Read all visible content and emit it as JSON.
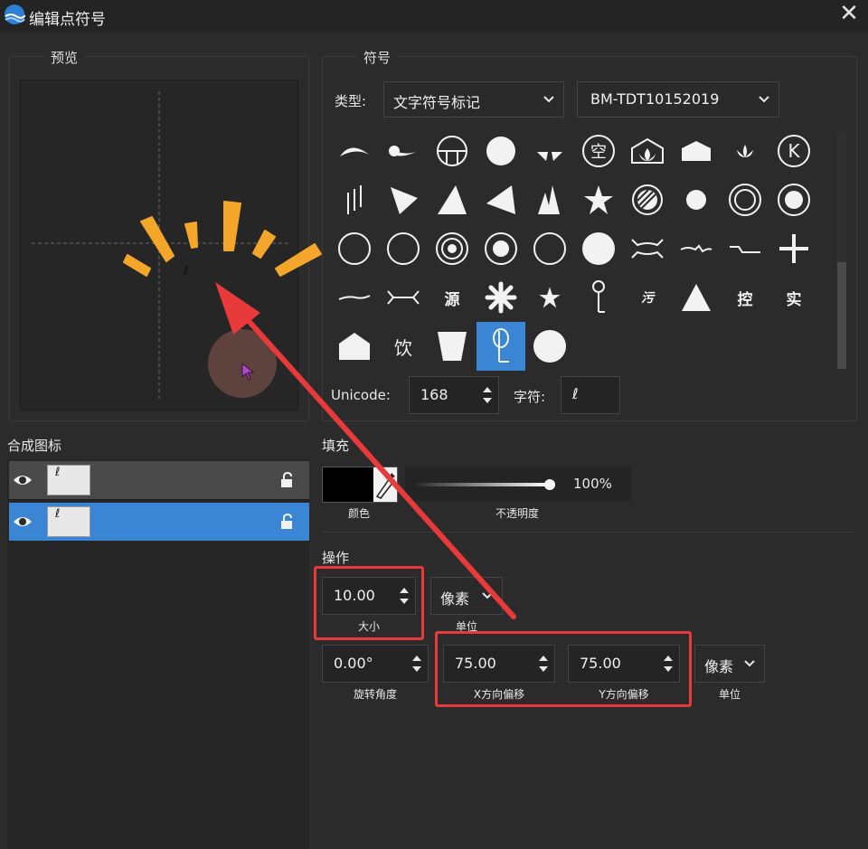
{
  "window": {
    "title": "编辑点符号",
    "close_icon": "close-icon"
  },
  "preview": {
    "group_title": "预览",
    "symbol_glyph": "ℓ"
  },
  "symbol": {
    "group_title": "符号",
    "type_label": "类型:",
    "type_value": "文字符号标记",
    "font_value": "BM-TDT10152019",
    "grid_text_items": {
      "yuan": "源",
      "wu": "污",
      "kong": "控",
      "shi": "实",
      "yin": "饮",
      "kong_circle": "空",
      "k": "K"
    },
    "unicode_label": "Unicode:",
    "unicode_value": "168",
    "char_label": "字符:",
    "char_value": "ℓ"
  },
  "layers": {
    "title": "合成图标",
    "items": [
      {
        "glyph": "ℓ",
        "selected": false
      },
      {
        "glyph": "ℓ",
        "selected": true
      }
    ]
  },
  "fill": {
    "title": "填充",
    "color_caption": "颜色",
    "color_value": "#000000",
    "opacity_caption": "不透明度",
    "opacity_value": "100%",
    "opacity_fraction": 1.0
  },
  "operation": {
    "title": "操作",
    "size_value": "10.00",
    "size_caption": "大小",
    "size_unit_value": "像素",
    "size_unit_caption": "单位",
    "rotation_value": "0.00°",
    "rotation_caption": "旋转角度",
    "x_offset_value": "75.00",
    "x_offset_caption": "X方向偏移",
    "y_offset_value": "75.00",
    "y_offset_caption": "Y方向偏移",
    "offset_unit_value": "像素",
    "offset_unit_caption": "单位"
  },
  "colors": {
    "accent": "#3b86d4",
    "highlight": "#e83a3a",
    "burst": "#f4a62a"
  }
}
